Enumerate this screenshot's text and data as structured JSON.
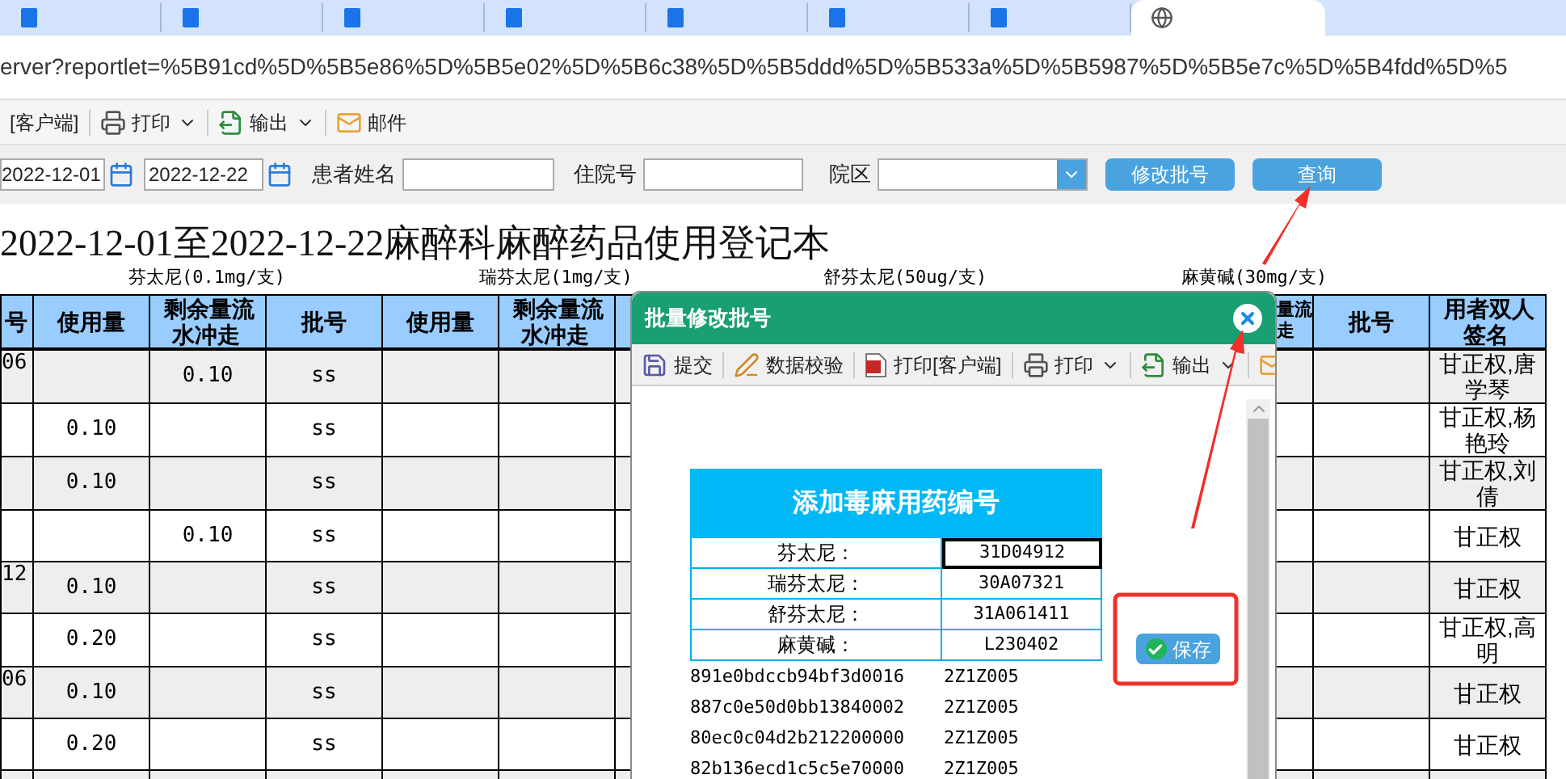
{
  "browser_tabs": [
    {
      "selected": false
    },
    {
      "selected": false
    },
    {
      "selected": false
    },
    {
      "selected": false
    },
    {
      "selected": false
    },
    {
      "selected": false
    },
    {
      "selected": false
    },
    {
      "selected": true
    }
  ],
  "address_bar": {
    "url": "erver?reportlet=%5B91cd%5D%5B5e86%5D%5B5e02%5D%5B6c38%5D%5B5ddd%5D%5B533a%5D%5B5987%5D%5B5e7c%5D%5B4fdd%5D%5"
  },
  "toolbar": [
    {
      "kind": "text",
      "label": "[客户端]"
    },
    {
      "kind": "print",
      "label": "打印",
      "dropdown": true
    },
    {
      "kind": "export",
      "label": "输出",
      "dropdown": true
    },
    {
      "kind": "mail",
      "label": "邮件",
      "dropdown": false
    }
  ],
  "filters": {
    "date_from": "2022-12-01",
    "date_to": "2022-12-22",
    "patient_name_label": "患者姓名",
    "admission_no_label": "住院号",
    "campus_label": "院区",
    "buttons": [
      "修改批号",
      "查询"
    ]
  },
  "report": {
    "title": "2022-12-01至2022-12-22麻醉科麻醉药品使用登记本",
    "drug_groups": [
      "芬太尼(0.1mg/支)",
      "瑞芬太尼(1mg/支)",
      "舒芬太尼(50ug/支)",
      "麻黄碱(30mg/支)"
    ],
    "left_columns": [
      "号",
      "使用量",
      "剩余量流水冲走",
      "批号",
      "使用量",
      "剩余量流水冲走"
    ],
    "right_columns": [
      "量流走",
      "批号",
      "用者双人签名"
    ],
    "rows": [
      {
        "column_1": "06",
        "fentanyl_remaining": "0.10",
        "fentanyl_batch": "ss",
        "signature": "甘正权,唐学琴"
      },
      {
        "fentanyl_usage": "0.10",
        "fentanyl_batch": "ss",
        "signature": "甘正权,杨艳玲"
      },
      {
        "fentanyl_usage": "0.10",
        "fentanyl_batch": "ss",
        "signature": "甘正权,刘倩"
      },
      {
        "fentanyl_remaining": "0.10",
        "fentanyl_batch": "ss",
        "signature": "甘正权"
      },
      {
        "column_1": "12",
        "fentanyl_usage": "0.10",
        "fentanyl_batch": "ss",
        "signature": "甘正权"
      },
      {
        "fentanyl_usage": "0.20",
        "fentanyl_batch": "ss",
        "signature": "甘正权,高明"
      },
      {
        "column_1": "06",
        "fentanyl_usage": "0.10",
        "fentanyl_batch": "ss",
        "signature": "甘正权"
      },
      {
        "fentanyl_usage": "0.20",
        "fentanyl_batch": "ss",
        "signature": "甘正权"
      }
    ]
  },
  "dialog": {
    "title": "批量修改批号",
    "toolbar": [
      {
        "kind": "save",
        "label": "提交"
      },
      {
        "kind": "check",
        "label": "数据校验"
      },
      {
        "kind": "pdf",
        "label": "打印[客户端]"
      },
      {
        "kind": "print",
        "label": "打印",
        "dropdown": true
      },
      {
        "kind": "export",
        "label": "输出",
        "dropdown": true
      },
      {
        "kind": "mail"
      }
    ],
    "form": {
      "heading": "添加毒麻用药编号",
      "fields": [
        {
          "label": "芬太尼：",
          "value": "31D04912",
          "focused": true
        },
        {
          "label": "瑞芬太尼：",
          "value": "30A07321",
          "focused": false
        },
        {
          "label": "舒芬太尼：",
          "value": "31A061411",
          "focused": false
        },
        {
          "label": "麻黄碱：",
          "value": "L230402",
          "focused": false
        }
      ]
    },
    "list": [
      {
        "id": "891e0bdccb94bf3d0016",
        "batch": "2Z1Z005"
      },
      {
        "id": "887c0e50d0bb13840002",
        "batch": "2Z1Z005"
      },
      {
        "id": "80ec0c04d2b212200000",
        "batch": "2Z1Z005"
      },
      {
        "id": "82b136ecd1c5c5e70000",
        "batch": "2Z1Z005"
      }
    ],
    "save_button": "保存"
  }
}
